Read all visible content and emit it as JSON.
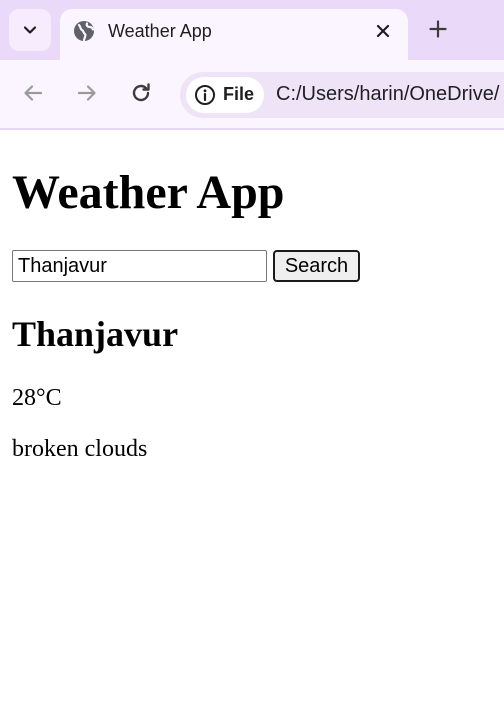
{
  "browser": {
    "tab": {
      "title": "Weather App",
      "favicon": "globe-icon"
    },
    "omnibox": {
      "site_chip_label": "File",
      "site_chip_icon": "info-icon",
      "url": "C:/Users/harin/OneDrive/"
    },
    "icons": {
      "tab_search": "chevron-down-icon",
      "close_tab": "close-icon",
      "new_tab": "plus-icon",
      "back": "arrow-left-icon",
      "forward": "arrow-right-icon",
      "reload": "reload-icon"
    },
    "colors": {
      "tabstrip_bg": "#ead9f8",
      "toolbar_bg": "#fbf5ff",
      "omnibox_bg": "#efe3f8"
    }
  },
  "app": {
    "title": "Weather App",
    "search": {
      "value": "Thanjavur",
      "placeholder": "",
      "button_label": "Search"
    },
    "weather": {
      "city": "Thanjavur",
      "temperature": "28°C",
      "description": "broken clouds"
    }
  }
}
